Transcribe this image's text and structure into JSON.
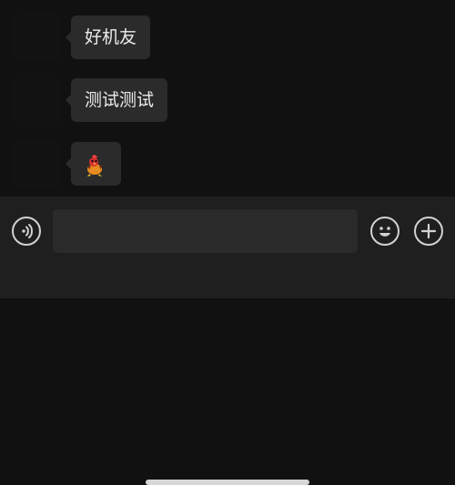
{
  "messages": [
    {
      "text": "好机友"
    },
    {
      "text": "测试测试"
    },
    {
      "text": ""
    }
  ],
  "input": {
    "value": "",
    "placeholder": ""
  },
  "icons": {
    "voice": "voice-icon",
    "emoji": "emoji-icon",
    "plus": "plus-icon",
    "sticker": "duck-sticker-icon"
  },
  "colors": {
    "background": "#111111",
    "bubble": "#2b2b2b",
    "input_bar": "#1f1f1f",
    "input_field": "#2a2a2a",
    "icon_stroke": "#d2d2d2"
  }
}
